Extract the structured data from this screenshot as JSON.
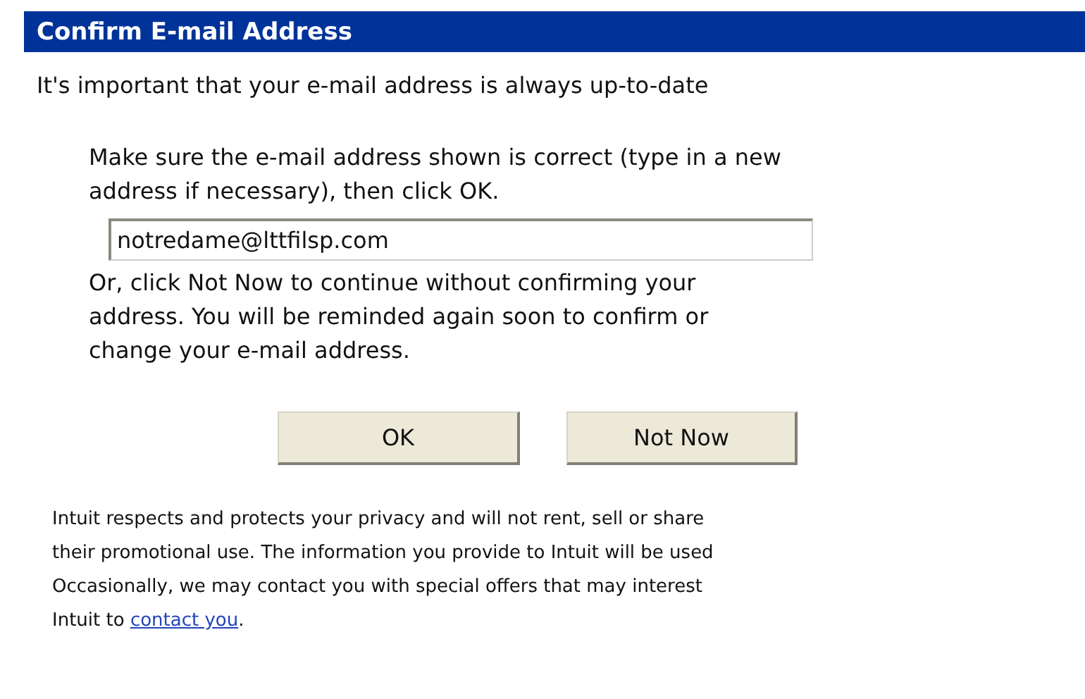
{
  "header": {
    "title": "Confirm E-mail Address"
  },
  "intro": "It's important that your e-mail address is always up-to-date",
  "instructions": [
    "Make sure the e-mail address shown is correct (type in a new",
    "address if necessary), then click OK."
  ],
  "email_field": {
    "value": "notredame@lttfilsp.com"
  },
  "alternative": [
    "Or, click Not Now to continue without confirming your",
    "address. You will be reminded again soon to confirm or",
    "change your e-mail address."
  ],
  "buttons": [
    "OK",
    "Not Now"
  ],
  "privacy": {
    "lines": [
      "Intuit respects and protects your privacy and will not rent, sell or share",
      "their promotional use. The information you provide to Intuit will be used",
      "Occasionally, we may contact you with special offers that may interest"
    ],
    "last_line": "Intuit to",
    "link": "contact you",
    "end": "."
  }
}
